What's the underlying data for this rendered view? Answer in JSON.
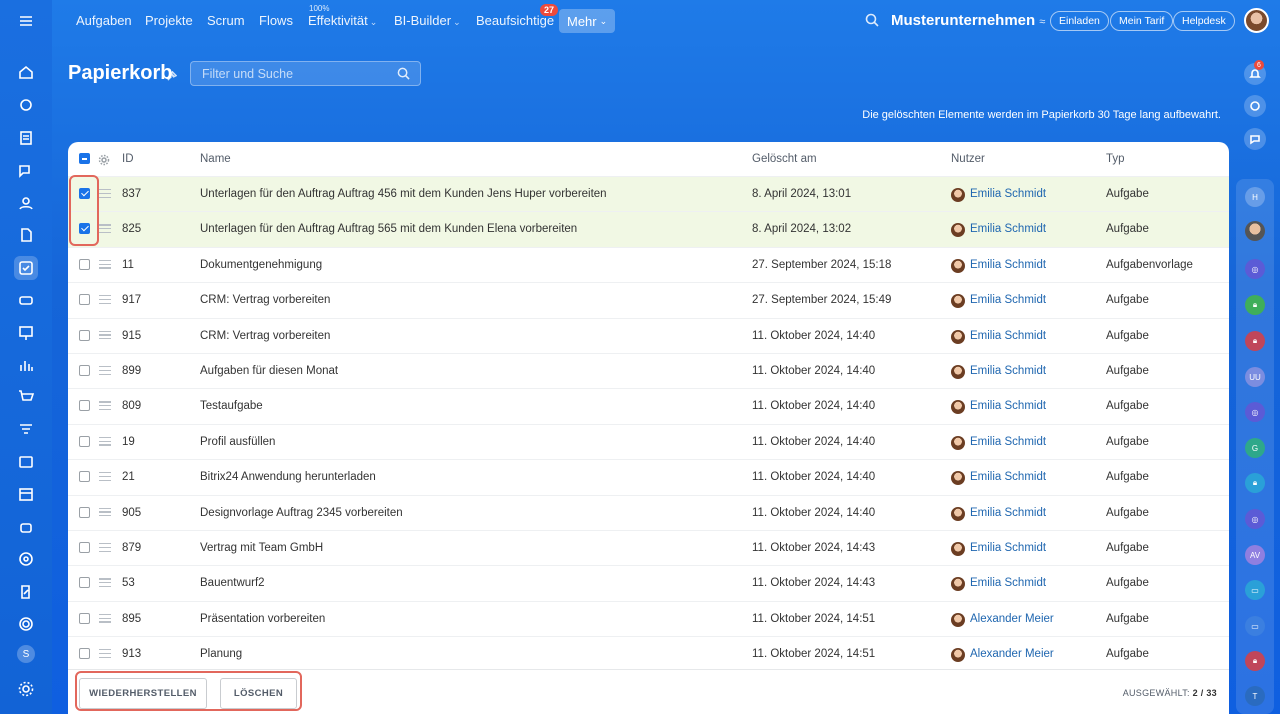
{
  "nav": {
    "items": [
      "Aufgaben",
      "Projekte",
      "Scrum",
      "Flows",
      "Effektivität",
      "BI-Builder",
      "Beaufsichtige",
      "Mehr"
    ],
    "effektivitaet_percent": "100%",
    "beaufsichtige_badge": "27"
  },
  "header": {
    "company": "Musterunternehmen",
    "buttons": [
      "Einladen",
      "Mein Tarif",
      "Helpdesk"
    ]
  },
  "page": {
    "title": "Papierkorb",
    "filter_placeholder": "Filter und Suche",
    "info": "Die gelöschten Elemente werden im Papierkorb 30 Tage lang aufbewahrt."
  },
  "table": {
    "columns": [
      "ID",
      "Name",
      "Gelöscht am",
      "Nutzer",
      "Typ"
    ],
    "rows": [
      {
        "checked": true,
        "id": "837",
        "name": "Unterlagen für den Auftrag Auftrag 456 mit dem Kunden Jens Huper vorbereiten",
        "deleted": "8. April 2024, 13:01",
        "user": "Emilia Schmidt",
        "type": "Aufgabe"
      },
      {
        "checked": true,
        "id": "825",
        "name": "Unterlagen für den Auftrag Auftrag 565 mit dem Kunden Elena vorbereiten",
        "deleted": "8. April 2024, 13:02",
        "user": "Emilia Schmidt",
        "type": "Aufgabe"
      },
      {
        "checked": false,
        "id": "11",
        "name": "Dokumentgenehmigung",
        "deleted": "27. September 2024, 15:18",
        "user": "Emilia Schmidt",
        "type": "Aufgabenvorlage"
      },
      {
        "checked": false,
        "id": "917",
        "name": "CRM: Vertrag vorbereiten",
        "deleted": "27. September 2024, 15:49",
        "user": "Emilia Schmidt",
        "type": "Aufgabe"
      },
      {
        "checked": false,
        "id": "915",
        "name": "CRM: Vertrag vorbereiten",
        "deleted": "11. Oktober 2024, 14:40",
        "user": "Emilia Schmidt",
        "type": "Aufgabe"
      },
      {
        "checked": false,
        "id": "899",
        "name": "Aufgaben für diesen Monat",
        "deleted": "11. Oktober 2024, 14:40",
        "user": "Emilia Schmidt",
        "type": "Aufgabe"
      },
      {
        "checked": false,
        "id": "809",
        "name": "Testaufgabe",
        "deleted": "11. Oktober 2024, 14:40",
        "user": "Emilia Schmidt",
        "type": "Aufgabe"
      },
      {
        "checked": false,
        "id": "19",
        "name": "Profil ausfüllen",
        "deleted": "11. Oktober 2024, 14:40",
        "user": "Emilia Schmidt",
        "type": "Aufgabe"
      },
      {
        "checked": false,
        "id": "21",
        "name": "Bitrix24 Anwendung herunterladen",
        "deleted": "11. Oktober 2024, 14:40",
        "user": "Emilia Schmidt",
        "type": "Aufgabe"
      },
      {
        "checked": false,
        "id": "905",
        "name": "Designvorlage Auftrag 2345 vorbereiten",
        "deleted": "11. Oktober 2024, 14:40",
        "user": "Emilia Schmidt",
        "type": "Aufgabe"
      },
      {
        "checked": false,
        "id": "879",
        "name": "Vertrag mit Team GmbH",
        "deleted": "11. Oktober 2024, 14:43",
        "user": "Emilia Schmidt",
        "type": "Aufgabe"
      },
      {
        "checked": false,
        "id": "53",
        "name": "Bauentwurf2",
        "deleted": "11. Oktober 2024, 14:43",
        "user": "Emilia Schmidt",
        "type": "Aufgabe"
      },
      {
        "checked": false,
        "id": "895",
        "name": "Präsentation vorbereiten",
        "deleted": "11. Oktober 2024, 14:51",
        "user": "Alexander Meier",
        "type": "Aufgabe"
      },
      {
        "checked": false,
        "id": "913",
        "name": "Planung",
        "deleted": "11. Oktober 2024, 14:51",
        "user": "Alexander Meier",
        "type": "Aufgabe"
      }
    ]
  },
  "footer": {
    "restore_label": "WIEDERHERSTELLEN",
    "delete_label": "LÖSCHEN",
    "selected_label": "AUSGEWÄHLT:",
    "selected_value": "2 / 33"
  },
  "rightbar": {
    "notif_badge": "6",
    "avatars": [
      "H",
      "UU",
      "G",
      "AV",
      "T"
    ]
  },
  "leftbar": {
    "user_initial": "S"
  },
  "colors": {
    "accent": "#1a73e8",
    "highlight": "#e2675c",
    "selected_row": "#f1f8e4",
    "link": "#2067b0"
  }
}
